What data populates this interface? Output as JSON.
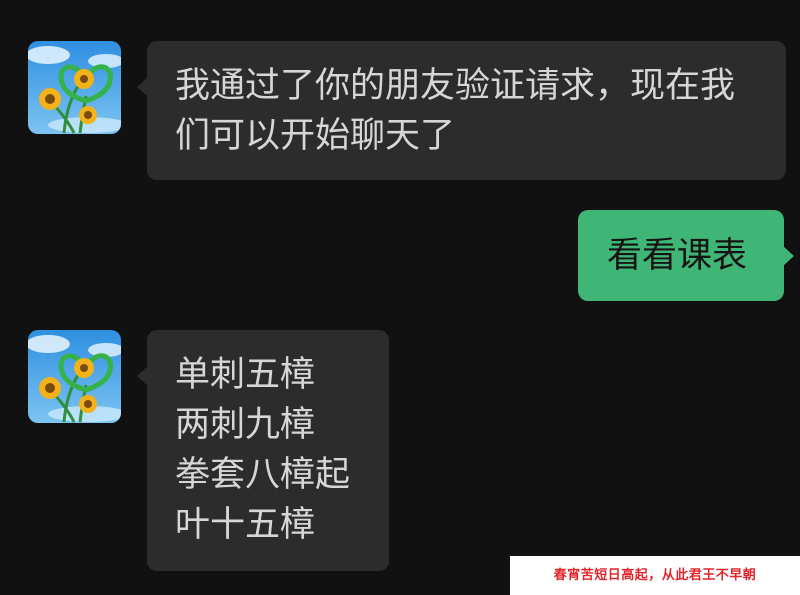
{
  "conversation": {
    "messages": [
      {
        "sender": "contact",
        "lines": [
          "我通过了你的朋友验证请求，现在我",
          "们可以开始聊天了"
        ]
      },
      {
        "sender": "me",
        "lines": [
          "看看课表"
        ]
      },
      {
        "sender": "contact",
        "lines": [
          "单刺五樟",
          "两刺九樟",
          "拳套八樟起",
          "叶十五樟"
        ]
      }
    ]
  },
  "watermark": {
    "text": "春宵苦短日高起，从此君王不早朝"
  },
  "colors": {
    "background": "#111111",
    "incoming_bubble": "#2c2c2c",
    "outgoing_bubble": "#3fb675",
    "incoming_text": "#d6d6d6",
    "outgoing_text": "#141414",
    "watermark_text": "#e0262c"
  },
  "icons": {
    "avatar": "sunflower-avatar-icon"
  }
}
